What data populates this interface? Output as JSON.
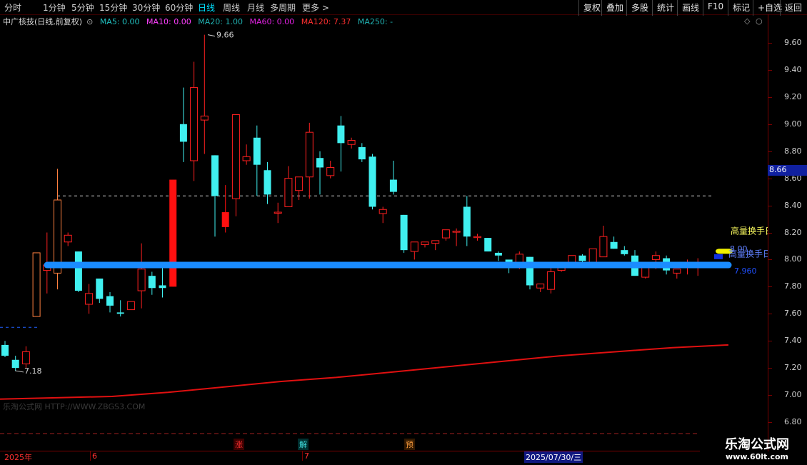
{
  "toolbar": {
    "periods": [
      "分时",
      "1分钟",
      "5分钟",
      "15分钟",
      "30分钟",
      "60分钟",
      "日线",
      "周线",
      "月线",
      "多周期",
      "更多 >"
    ],
    "active_period": "日线",
    "right_buttons": [
      "复权",
      "叠加",
      "多股",
      "统计",
      "画线",
      "F10",
      "标记",
      "+自选",
      "返回"
    ]
  },
  "info": {
    "title": "中广核技(日线,前复权)",
    "ma5": "MA5: 0.00",
    "ma10": "MA10: 0.00",
    "ma20": "MA20: 1.00",
    "ma60": "MA60: 0.00",
    "ma120": "MA120: 7.37",
    "ma250": "MA250: -"
  },
  "colors": {
    "up": "#ff2020",
    "down": "#40f0f0",
    "ma120": "#e01010",
    "blue_line": "#1a8cff",
    "ma5": "#20c0c0",
    "ma10": "#ff40ff",
    "ma20": "#20b0b0",
    "ma60": "#e020e0",
    "ma120_text": "#ff3030"
  },
  "chart_data": {
    "type": "candlestick",
    "ylim": [
      6.8,
      9.7
    ],
    "yticks": [
      "9.60",
      "9.40",
      "9.20",
      "9.00",
      "8.80",
      "8.60",
      "8.40",
      "8.20",
      "8.00",
      "7.80",
      "7.60",
      "7.40",
      "7.20",
      "7.00",
      "6.80"
    ],
    "current_price": "8.66",
    "high_label": "9.66",
    "low_label": "7.18",
    "support_line_label": "7.960",
    "support_line_value": 7.96,
    "dashed_level_high": 8.47,
    "dashed_level_low": 7.5,
    "annotation_text": "高量换手日",
    "annotation_text2": "高量换手日",
    "annotation_value": "8.00",
    "candles": [
      {
        "o": 7.37,
        "h": 7.4,
        "l": 7.28,
        "c": 7.29
      },
      {
        "o": 7.26,
        "h": 7.29,
        "l": 7.18,
        "c": 7.2
      },
      {
        "o": 7.23,
        "h": 7.36,
        "l": 7.2,
        "c": 7.32
      },
      {
        "o": 7.58,
        "h": 8.05,
        "l": 7.58,
        "c": 8.05
      },
      {
        "o": 7.92,
        "h": 8.2,
        "l": 7.75,
        "c": 7.96
      },
      {
        "o": 7.9,
        "h": 8.67,
        "l": 7.78,
        "c": 8.44
      },
      {
        "o": 8.13,
        "h": 8.2,
        "l": 8.1,
        "c": 8.18
      },
      {
        "o": 8.06,
        "h": 8.06,
        "l": 7.76,
        "c": 7.77
      },
      {
        "o": 7.67,
        "h": 7.82,
        "l": 7.6,
        "c": 7.75
      },
      {
        "o": 7.86,
        "h": 7.86,
        "l": 7.68,
        "c": 7.71
      },
      {
        "o": 7.73,
        "h": 7.76,
        "l": 7.61,
        "c": 7.66
      },
      {
        "o": 7.61,
        "h": 7.7,
        "l": 7.58,
        "c": 7.6
      },
      {
        "o": 7.63,
        "h": 7.69,
        "l": 7.63,
        "c": 7.69
      },
      {
        "o": 7.77,
        "h": 8.12,
        "l": 7.64,
        "c": 7.93
      },
      {
        "o": 7.88,
        "h": 7.91,
        "l": 7.74,
        "c": 7.79
      },
      {
        "o": 7.81,
        "h": 7.97,
        "l": 7.72,
        "c": 7.79
      },
      {
        "o": 7.8,
        "h": 8.59,
        "l": 7.8,
        "c": 8.59
      },
      {
        "o": 9.0,
        "h": 9.27,
        "l": 8.72,
        "c": 8.87
      },
      {
        "o": 8.73,
        "h": 9.46,
        "l": 8.58,
        "c": 9.27
      },
      {
        "o": 9.03,
        "h": 9.66,
        "l": 8.78,
        "c": 9.06
      },
      {
        "o": 8.77,
        "h": 8.77,
        "l": 8.17,
        "c": 8.47
      },
      {
        "o": 8.35,
        "h": 8.55,
        "l": 8.2,
        "c": 8.24
      },
      {
        "o": 8.45,
        "h": 9.07,
        "l": 8.32,
        "c": 9.07
      },
      {
        "o": 8.73,
        "h": 8.85,
        "l": 8.7,
        "c": 8.76
      },
      {
        "o": 8.9,
        "h": 8.99,
        "l": 8.47,
        "c": 8.7
      },
      {
        "o": 8.66,
        "h": 8.72,
        "l": 8.41,
        "c": 8.48
      },
      {
        "o": 8.35,
        "h": 8.42,
        "l": 8.27,
        "c": 8.35
      },
      {
        "o": 8.39,
        "h": 8.69,
        "l": 8.39,
        "c": 8.6
      },
      {
        "o": 8.51,
        "h": 8.61,
        "l": 8.44,
        "c": 8.61
      },
      {
        "o": 8.61,
        "h": 9.01,
        "l": 8.45,
        "c": 8.94
      },
      {
        "o": 8.75,
        "h": 8.8,
        "l": 8.48,
        "c": 8.68
      },
      {
        "o": 8.62,
        "h": 8.73,
        "l": 8.6,
        "c": 8.68
      },
      {
        "o": 8.99,
        "h": 9.06,
        "l": 8.65,
        "c": 8.86
      },
      {
        "o": 8.85,
        "h": 8.9,
        "l": 8.82,
        "c": 8.88
      },
      {
        "o": 8.83,
        "h": 8.86,
        "l": 8.72,
        "c": 8.74
      },
      {
        "o": 8.76,
        "h": 8.78,
        "l": 8.37,
        "c": 8.39
      },
      {
        "o": 8.34,
        "h": 8.39,
        "l": 8.27,
        "c": 8.37
      },
      {
        "o": 8.59,
        "h": 8.73,
        "l": 8.48,
        "c": 8.5
      },
      {
        "o": 8.33,
        "h": 8.33,
        "l": 8.05,
        "c": 8.07
      },
      {
        "o": 8.06,
        "h": 8.13,
        "l": 8.0,
        "c": 8.13
      },
      {
        "o": 8.11,
        "h": 8.13,
        "l": 8.09,
        "c": 8.13
      },
      {
        "o": 8.12,
        "h": 8.14,
        "l": 8.07,
        "c": 8.14
      },
      {
        "o": 8.16,
        "h": 8.22,
        "l": 8.14,
        "c": 8.22
      },
      {
        "o": 8.21,
        "h": 8.23,
        "l": 8.1,
        "c": 8.21
      },
      {
        "o": 8.39,
        "h": 8.47,
        "l": 8.1,
        "c": 8.17
      },
      {
        "o": 8.17,
        "h": 8.19,
        "l": 8.14,
        "c": 8.17
      },
      {
        "o": 8.16,
        "h": 8.16,
        "l": 8.06,
        "c": 8.06
      },
      {
        "o": 8.05,
        "h": 8.06,
        "l": 7.99,
        "c": 8.03
      },
      {
        "o": 8.0,
        "h": 7.99,
        "l": 7.9,
        "c": 7.98
      },
      {
        "o": 7.98,
        "h": 8.06,
        "l": 7.93,
        "c": 8.04
      },
      {
        "o": 8.02,
        "h": 8.02,
        "l": 7.78,
        "c": 7.81
      },
      {
        "o": 7.79,
        "h": 7.82,
        "l": 7.76,
        "c": 7.82
      },
      {
        "o": 7.78,
        "h": 7.96,
        "l": 7.75,
        "c": 7.91
      },
      {
        "o": 7.92,
        "h": 7.95,
        "l": 7.91,
        "c": 7.95
      },
      {
        "o": 7.97,
        "h": 8.03,
        "l": 7.95,
        "c": 8.03
      },
      {
        "o": 8.03,
        "h": 8.04,
        "l": 7.98,
        "c": 7.99
      },
      {
        "o": 7.98,
        "h": 8.08,
        "l": 7.95,
        "c": 8.08
      },
      {
        "o": 8.02,
        "h": 8.25,
        "l": 8.02,
        "c": 8.17
      },
      {
        "o": 8.13,
        "h": 8.17,
        "l": 8.08,
        "c": 8.08
      },
      {
        "o": 8.07,
        "h": 8.1,
        "l": 8.03,
        "c": 8.04
      },
      {
        "o": 8.03,
        "h": 8.07,
        "l": 7.88,
        "c": 7.88
      },
      {
        "o": 7.87,
        "h": 7.96,
        "l": 7.86,
        "c": 7.96
      },
      {
        "o": 8.0,
        "h": 8.06,
        "l": 7.93,
        "c": 8.03
      },
      {
        "o": 8.01,
        "h": 8.03,
        "l": 7.89,
        "c": 7.92
      },
      {
        "o": 7.9,
        "h": 7.93,
        "l": 7.86,
        "c": 7.93
      },
      {
        "o": 7.94,
        "h": 8.0,
        "l": 7.89,
        "c": 7.98
      },
      {
        "o": 7.96,
        "h": 8.01,
        "l": 7.88,
        "c": 7.97
      }
    ],
    "ma120_line": [
      6.97,
      6.98,
      6.99,
      7.02,
      7.06,
      7.1,
      7.13,
      7.17,
      7.21,
      7.25,
      7.29,
      7.32,
      7.35,
      7.37
    ],
    "special_candles": [
      {
        "index": 3,
        "color": "#ff8040"
      },
      {
        "index": 5,
        "color": "#ff8040"
      },
      {
        "index": 16,
        "color": "#ff1010",
        "solid": true
      },
      {
        "index": 21,
        "color": "#ff1010",
        "solid": true
      }
    ]
  },
  "date_bar": {
    "year": "2025年",
    "m6": "6",
    "m7": "7",
    "cursor_date": "2025/07/30/三"
  },
  "markers": {
    "zhang": "涨",
    "jie": "解",
    "yu": "预"
  },
  "watermark": {
    "logo": "乐淘公式网",
    "url": "www.60lt.com",
    "faint_text": "乐淘公式网 HTTP://WWW.ZBGS3.COM"
  }
}
